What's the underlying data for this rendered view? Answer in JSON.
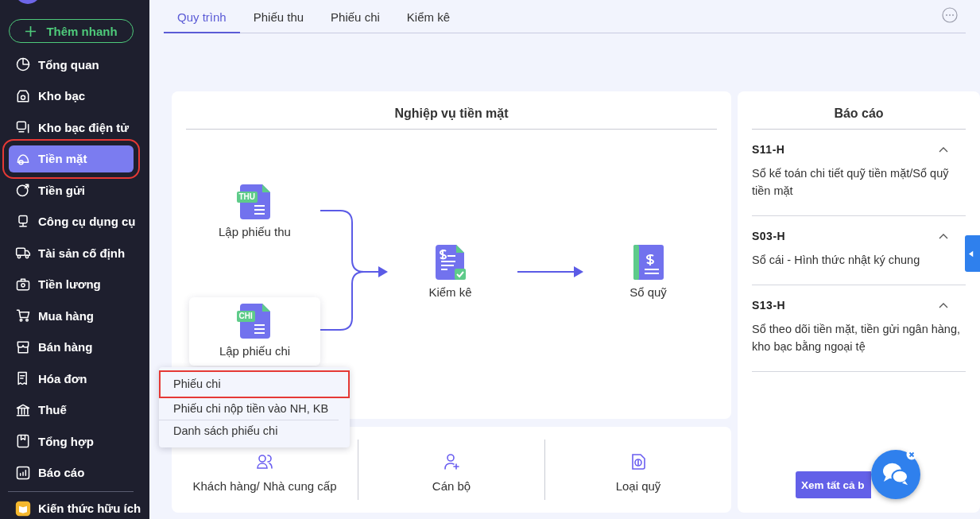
{
  "sidebar": {
    "quick_add": "Thêm nhanh",
    "items": [
      {
        "label": "Tổng quan",
        "selected": false,
        "highlighted": false
      },
      {
        "label": "Kho bạc",
        "selected": false,
        "highlighted": false
      },
      {
        "label": "Kho bạc điện tử",
        "selected": false,
        "highlighted": false
      },
      {
        "label": "Tiền mặt",
        "selected": true,
        "highlighted": true
      },
      {
        "label": "Tiền gửi",
        "selected": false,
        "highlighted": false
      },
      {
        "label": "Công cụ dụng cụ",
        "selected": false,
        "highlighted": false
      },
      {
        "label": "Tài sản cố định",
        "selected": false,
        "highlighted": false
      },
      {
        "label": "Tiền lương",
        "selected": false,
        "highlighted": false
      },
      {
        "label": "Mua hàng",
        "selected": false,
        "highlighted": false
      },
      {
        "label": "Bán hàng",
        "selected": false,
        "highlighted": false
      },
      {
        "label": "Hóa đơn",
        "selected": false,
        "highlighted": false
      },
      {
        "label": "Thuế",
        "selected": false,
        "highlighted": false
      },
      {
        "label": "Tổng hợp",
        "selected": false,
        "highlighted": false
      },
      {
        "label": "Báo cáo",
        "selected": false,
        "highlighted": false
      }
    ],
    "footer_item": "Kiến thức hữu ích"
  },
  "tabs": [
    {
      "label": "Quy trình",
      "selected": true
    },
    {
      "label": "Phiếu thu",
      "selected": false
    },
    {
      "label": "Phiếu chi",
      "selected": false
    },
    {
      "label": "Kiểm kê",
      "selected": false
    }
  ],
  "workflow": {
    "title": "Nghiệp vụ tiền mặt",
    "nodes": [
      {
        "kind": "voucher",
        "label": "Lập phiếu thu",
        "badge": "THU",
        "hovered": false
      },
      {
        "kind": "voucher",
        "label": "Lập phiếu chi",
        "badge": "CHI",
        "hovered": true
      },
      {
        "kind": "check",
        "label": "Kiểm kê",
        "hovered": false
      },
      {
        "kind": "book",
        "label": "Sổ quỹ",
        "hovered": false
      }
    ],
    "menu": [
      {
        "label": "Phiếu chi",
        "highlighted": true
      },
      {
        "label": "Phiếu chi nộp tiền vào NH, KB",
        "highlighted": false
      },
      {
        "label": "Danh sách phiếu chi",
        "highlighted": false
      }
    ]
  },
  "shortcuts": [
    {
      "label": "Khách hàng/ Nhà cung cấp"
    },
    {
      "label": "Cán bộ"
    },
    {
      "label": "Loại quỹ"
    }
  ],
  "reports": {
    "title": "Báo cáo",
    "items": [
      {
        "code": "S11-H",
        "description": "Sổ kế toán chi tiết quỹ tiền mặt/Sổ quỹ tiền mặt",
        "expanded": true
      },
      {
        "code": "S03-H",
        "description": "Sổ cái - Hình thức nhật ký chung",
        "expanded": true
      },
      {
        "code": "S13-H",
        "description": "Sổ theo dõi tiền mặt, tiền gửi ngân hàng, kho bạc bằng ngoại tệ",
        "expanded": true
      }
    ],
    "button": "Xem tất cả b"
  }
}
